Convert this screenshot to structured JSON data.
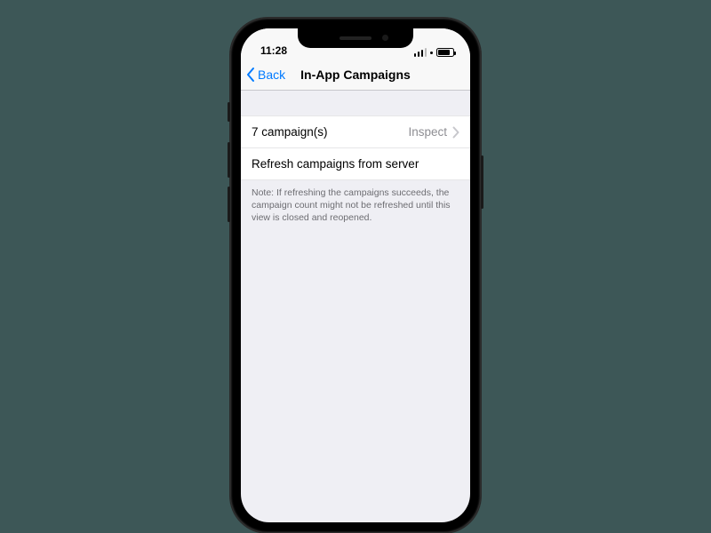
{
  "status": {
    "time": "11:28"
  },
  "nav": {
    "back_label": "Back",
    "title": "In-App Campaigns"
  },
  "rows": {
    "campaigns_label": "7 campaign(s)",
    "campaigns_detail": "Inspect",
    "refresh_label": "Refresh campaigns from server"
  },
  "footer_note": "Note: If refreshing the campaigns succeeds, the campaign count might not be refreshed until this view is closed and reopened."
}
